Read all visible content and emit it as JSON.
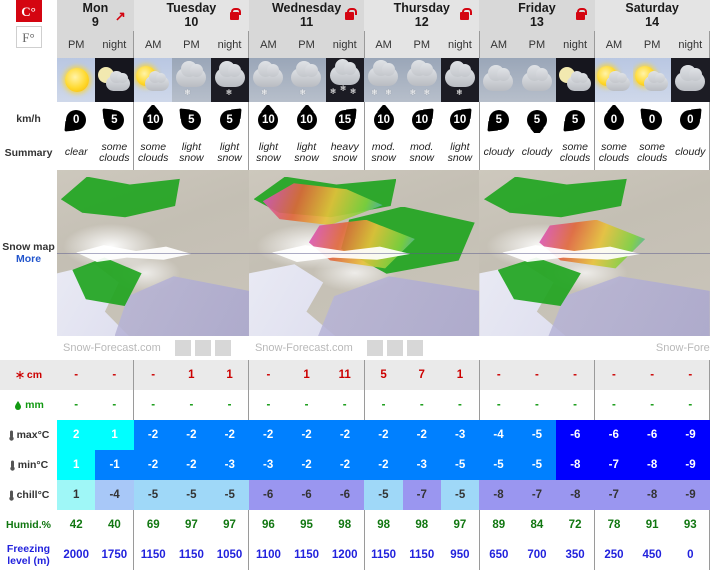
{
  "units": {
    "celsius": "C°",
    "fahrenheit": "F°",
    "selected": "C°"
  },
  "labels": {
    "wind": "km/h",
    "summary": "Summary",
    "snow_map": "Snow map",
    "more": "More",
    "snow": "cm",
    "rain": "mm",
    "max": "max°C",
    "min": "min°C",
    "chill": "chill°C",
    "humidity": "Humid.%",
    "freezing": "Freezing level (m)"
  },
  "watermark": {
    "text": "Snow-Forecast.com",
    "text_truncated": "Snow-Fore"
  },
  "days": [
    {
      "name": "Mon",
      "date": "9",
      "locked": false,
      "expand": true,
      "periods": [
        "PM",
        "night"
      ]
    },
    {
      "name": "Tuesday",
      "date": "10",
      "locked": true,
      "expand": false,
      "periods": [
        "AM",
        "PM",
        "night"
      ]
    },
    {
      "name": "Wednesday",
      "date": "11",
      "locked": true,
      "expand": false,
      "periods": [
        "AM",
        "PM",
        "night"
      ]
    },
    {
      "name": "Thursday",
      "date": "12",
      "locked": true,
      "expand": false,
      "periods": [
        "AM",
        "PM",
        "night"
      ]
    },
    {
      "name": "Friday",
      "date": "13",
      "locked": true,
      "expand": false,
      "periods": [
        "AM",
        "PM",
        "night"
      ]
    },
    {
      "name": "Saturday",
      "date": "14",
      "locked": false,
      "expand": false,
      "periods": [
        "AM",
        "PM",
        "night"
      ]
    }
  ],
  "columns": [
    {
      "day": 0,
      "period": "PM",
      "sky": "day",
      "icon": "sun",
      "wind": 0,
      "dir": "SW",
      "summary": "clear",
      "snow": "-",
      "rain": "-",
      "max": 2,
      "min": 1,
      "chill": 1,
      "hum": 42,
      "frz": 2000,
      "maxc": "#00ffff",
      "minc": "#00ffff",
      "chillc": "#9ff7f7"
    },
    {
      "day": 0,
      "period": "night",
      "sky": "night",
      "icon": "moon-cloud",
      "wind": 5,
      "dir": "NW",
      "summary": "some clouds",
      "snow": "-",
      "rain": "-",
      "max": 1,
      "min": -1,
      "chill": -4,
      "hum": 40,
      "frz": 1750,
      "maxc": "#00ffff",
      "minc": "#0080ff",
      "chillc": "#a8c8f8"
    },
    {
      "day": 1,
      "period": "AM",
      "sky": "day",
      "icon": "sun-cloud",
      "wind": 10,
      "dir": "N",
      "summary": "some clouds",
      "snow": "-",
      "rain": "-",
      "max": -2,
      "min": -2,
      "chill": -5,
      "hum": 69,
      "frz": 1150,
      "maxc": "#0080ff",
      "minc": "#0080ff",
      "chillc": "#9fd8f8"
    },
    {
      "day": 1,
      "period": "PM",
      "sky": "ov",
      "icon": "cloud-snow",
      "wind": 5,
      "dir": "NW",
      "summary": "light snow",
      "snow": "1",
      "rain": "-",
      "max": -2,
      "min": -2,
      "chill": -5,
      "hum": 97,
      "frz": 1150,
      "maxc": "#0080ff",
      "minc": "#0080ff",
      "chillc": "#9fd8f8"
    },
    {
      "day": 1,
      "period": "night",
      "sky": "ovn",
      "icon": "cloud-snow-n",
      "wind": 5,
      "dir": "NE",
      "summary": "light snow",
      "snow": "1",
      "rain": "-",
      "max": -2,
      "min": -3,
      "chill": -5,
      "hum": 97,
      "frz": 1050,
      "maxc": "#0080ff",
      "minc": "#0080ff",
      "chillc": "#9fd8f8"
    },
    {
      "day": 2,
      "period": "AM",
      "sky": "ov",
      "icon": "cloud-snow",
      "wind": 10,
      "dir": "N",
      "summary": "light snow",
      "snow": "-",
      "rain": "-",
      "max": -2,
      "min": -3,
      "chill": -6,
      "hum": 96,
      "frz": 1100,
      "maxc": "#0080ff",
      "minc": "#0080ff",
      "chillc": "#9a96f0"
    },
    {
      "day": 2,
      "period": "PM",
      "sky": "ov",
      "icon": "cloud-snow",
      "wind": 10,
      "dir": "N",
      "summary": "light snow",
      "snow": "1",
      "rain": "-",
      "max": -2,
      "min": -2,
      "chill": -6,
      "hum": 95,
      "frz": 1150,
      "maxc": "#0080ff",
      "minc": "#0080ff",
      "chillc": "#9a96f0"
    },
    {
      "day": 2,
      "period": "night",
      "sky": "ovn",
      "icon": "cloud-snow-heavy",
      "wind": 15,
      "dir": "NE",
      "summary": "heavy snow",
      "snow": "11",
      "rain": "-",
      "max": -2,
      "min": -2,
      "chill": -6,
      "hum": 98,
      "frz": 1200,
      "maxc": "#0080ff",
      "minc": "#0080ff",
      "chillc": "#9a96f0"
    },
    {
      "day": 3,
      "period": "AM",
      "sky": "ov",
      "icon": "cloud-snow-2",
      "wind": 10,
      "dir": "N",
      "summary": "mod. snow",
      "snow": "5",
      "rain": "-",
      "max": -2,
      "min": -2,
      "chill": -5,
      "hum": 98,
      "frz": 1150,
      "maxc": "#0080ff",
      "minc": "#0080ff",
      "chillc": "#9fd8f8"
    },
    {
      "day": 3,
      "period": "PM",
      "sky": "ov",
      "icon": "cloud-snow-2",
      "wind": 10,
      "dir": "NE",
      "summary": "mod. snow",
      "snow": "7",
      "rain": "-",
      "max": -2,
      "min": -3,
      "chill": -7,
      "hum": 98,
      "frz": 1150,
      "maxc": "#0080ff",
      "minc": "#0080ff",
      "chillc": "#9a96f0"
    },
    {
      "day": 3,
      "period": "night",
      "sky": "ovn",
      "icon": "cloud-snow-n",
      "wind": 10,
      "dir": "NE",
      "summary": "light snow",
      "snow": "1",
      "rain": "-",
      "max": -3,
      "min": -5,
      "chill": -5,
      "hum": 97,
      "frz": 950,
      "maxc": "#0080ff",
      "minc": "#0080ff",
      "chillc": "#9fd8f8"
    },
    {
      "day": 4,
      "period": "AM",
      "sky": "ov",
      "icon": "cloud",
      "wind": 5,
      "dir": "SW",
      "summary": "cloudy",
      "snow": "-",
      "rain": "-",
      "max": -4,
      "min": -5,
      "chill": -8,
      "hum": 89,
      "frz": 650,
      "maxc": "#0080ff",
      "minc": "#0080ff",
      "chillc": "#9a96f0"
    },
    {
      "day": 4,
      "period": "PM",
      "sky": "ov",
      "icon": "cloud",
      "wind": 5,
      "dir": "S",
      "summary": "cloudy",
      "snow": "-",
      "rain": "-",
      "max": -5,
      "min": -5,
      "chill": -7,
      "hum": 84,
      "frz": 700,
      "maxc": "#0080ff",
      "minc": "#0080ff",
      "chillc": "#9a96f0"
    },
    {
      "day": 4,
      "period": "night",
      "sky": "night",
      "icon": "moon-cloud",
      "wind": 5,
      "dir": "SW",
      "summary": "some clouds",
      "snow": "-",
      "rain": "-",
      "max": -6,
      "min": -8,
      "chill": -8,
      "hum": 72,
      "frz": 350,
      "maxc": "#0000ff",
      "minc": "#0000ff",
      "chillc": "#9a96f0"
    },
    {
      "day": 5,
      "period": "AM",
      "sky": "day",
      "icon": "sun-cloud",
      "wind": 0,
      "dir": "N",
      "summary": "some clouds",
      "snow": "-",
      "rain": "-",
      "max": -6,
      "min": -7,
      "chill": -7,
      "hum": 78,
      "frz": 250,
      "maxc": "#0000ff",
      "minc": "#0000ff",
      "chillc": "#9a96f0"
    },
    {
      "day": 5,
      "period": "PM",
      "sky": "day",
      "icon": "sun-cloud",
      "wind": 0,
      "dir": "NW",
      "summary": "some clouds",
      "snow": "-",
      "rain": "-",
      "max": -6,
      "min": -8,
      "chill": -8,
      "hum": 91,
      "frz": 450,
      "maxc": "#0000ff",
      "minc": "#0000ff",
      "chillc": "#9a96f0"
    },
    {
      "day": 5,
      "period": "night",
      "sky": "ovn",
      "icon": "cloud",
      "wind": 0,
      "dir": "NE",
      "summary": "cloudy",
      "snow": "-",
      "rain": "-",
      "max": -9,
      "min": -9,
      "chill": -9,
      "hum": 93,
      "frz": 0,
      "maxc": "#0000ff",
      "minc": "#0000ff",
      "chillc": "#9a96f0"
    }
  ]
}
